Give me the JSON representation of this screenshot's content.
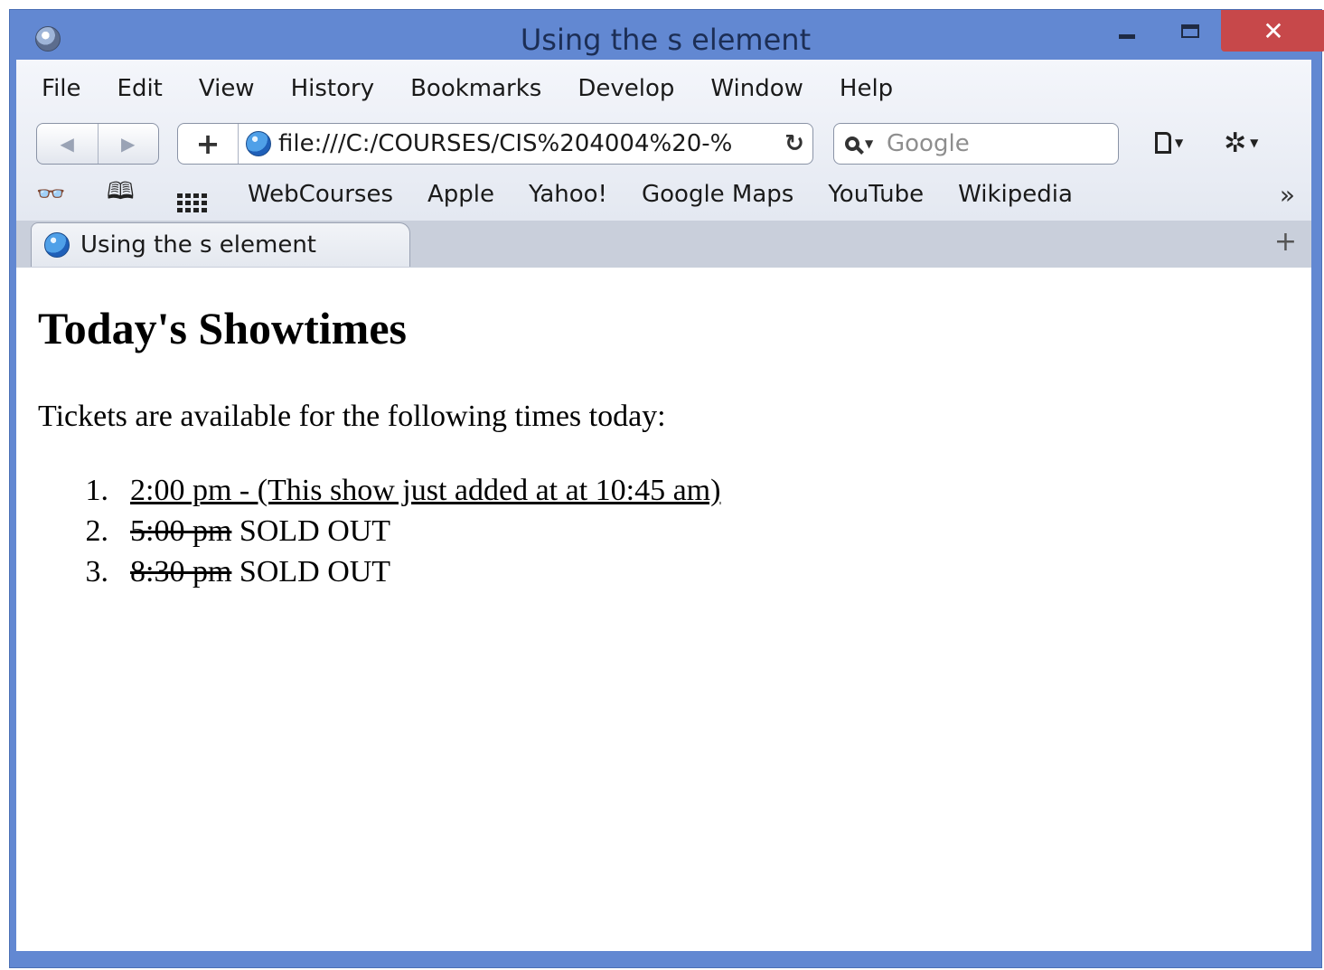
{
  "window": {
    "title": "Using the s element"
  },
  "menu": {
    "items": [
      "File",
      "Edit",
      "View",
      "History",
      "Bookmarks",
      "Develop",
      "Window",
      "Help"
    ]
  },
  "toolbar": {
    "back_label": "◀",
    "forward_label": "▶",
    "add_label": "+",
    "url": "file:///C:/COURSES/CIS%204004%20-%",
    "reload_label": "↻",
    "search_placeholder": "Google"
  },
  "bookmarks": {
    "items": [
      "WebCourses",
      "Apple",
      "Yahoo!",
      "Google Maps",
      "YouTube",
      "Wikipedia"
    ],
    "more_label": "»"
  },
  "tabs": [
    {
      "label": "Using the s element"
    }
  ],
  "new_tab_label": "+",
  "content": {
    "heading": "Today's Showtimes",
    "intro": "Tickets are available for the following times today:",
    "showtimes": [
      {
        "number": "1.",
        "time": "2:00 pm - (This show just added at at 10:45 am)",
        "status": "",
        "style": "inserted"
      },
      {
        "number": "2.",
        "time": "5:00 pm",
        "status": " SOLD OUT",
        "style": "struck"
      },
      {
        "number": "3.",
        "time": "8:30 pm",
        "status": " SOLD OUT",
        "style": "struck"
      }
    ]
  },
  "colors": {
    "window_frame": "#6288d2",
    "close_button": "#c7484a",
    "title_text": "#1c2e55"
  }
}
